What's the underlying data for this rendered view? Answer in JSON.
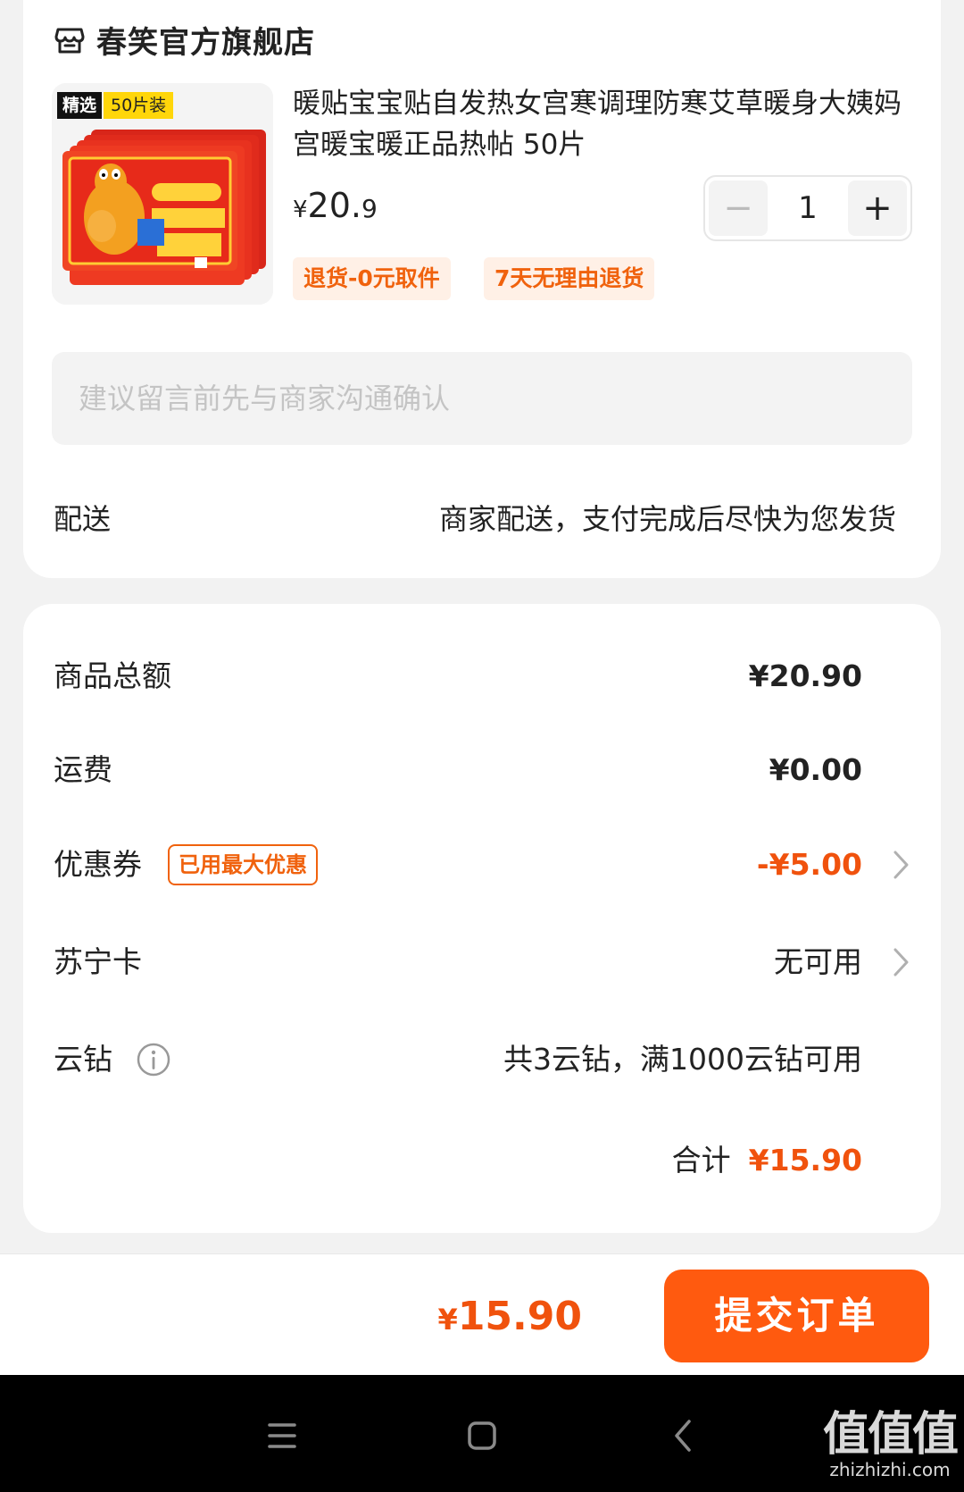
{
  "store": {
    "name": "春笑官方旗舰店",
    "icon": "store-icon"
  },
  "product": {
    "badge_selected": "精选",
    "badge_pack": "50片装",
    "title": "暖贴宝宝贴自发热女宫寒调理防寒艾草暖身大姨妈宫暖宝暖正品热帖 50片",
    "price_symbol": "¥",
    "price_int": "20.",
    "price_dec": "9",
    "quantity": "1",
    "minus": "−",
    "plus": "+",
    "tags": [
      "退货-0元取件",
      "7天无理由退货"
    ]
  },
  "remark": {
    "placeholder": "建议留言前先与商家沟通确认"
  },
  "shipping": {
    "label": "配送",
    "value": "商家配送，支付完成后尽快为您发货"
  },
  "summary": {
    "goods_total_label": "商品总额",
    "goods_total_value": "¥20.90",
    "freight_label": "运费",
    "freight_value": "¥0.00",
    "coupon_label": "优惠券",
    "coupon_badge": "已用最大优惠",
    "coupon_value": "-¥5.00",
    "suning_card_label": "苏宁卡",
    "suning_card_value": "无可用",
    "yunzuan_label": "云钻",
    "yunzuan_value": "共3云钻，满1000云钻可用",
    "total_label": "合计",
    "total_value": "¥15.90"
  },
  "bottom_bar": {
    "price_symbol": "¥",
    "price_value": "15.90",
    "submit_label": "提交订单"
  },
  "watermark": {
    "main": "值值值",
    "domain": "zhizhizhi.com"
  },
  "colors": {
    "accent": "#ff5a0f",
    "price_red": "#f0520d",
    "tag_bg": "#fff0e6"
  }
}
